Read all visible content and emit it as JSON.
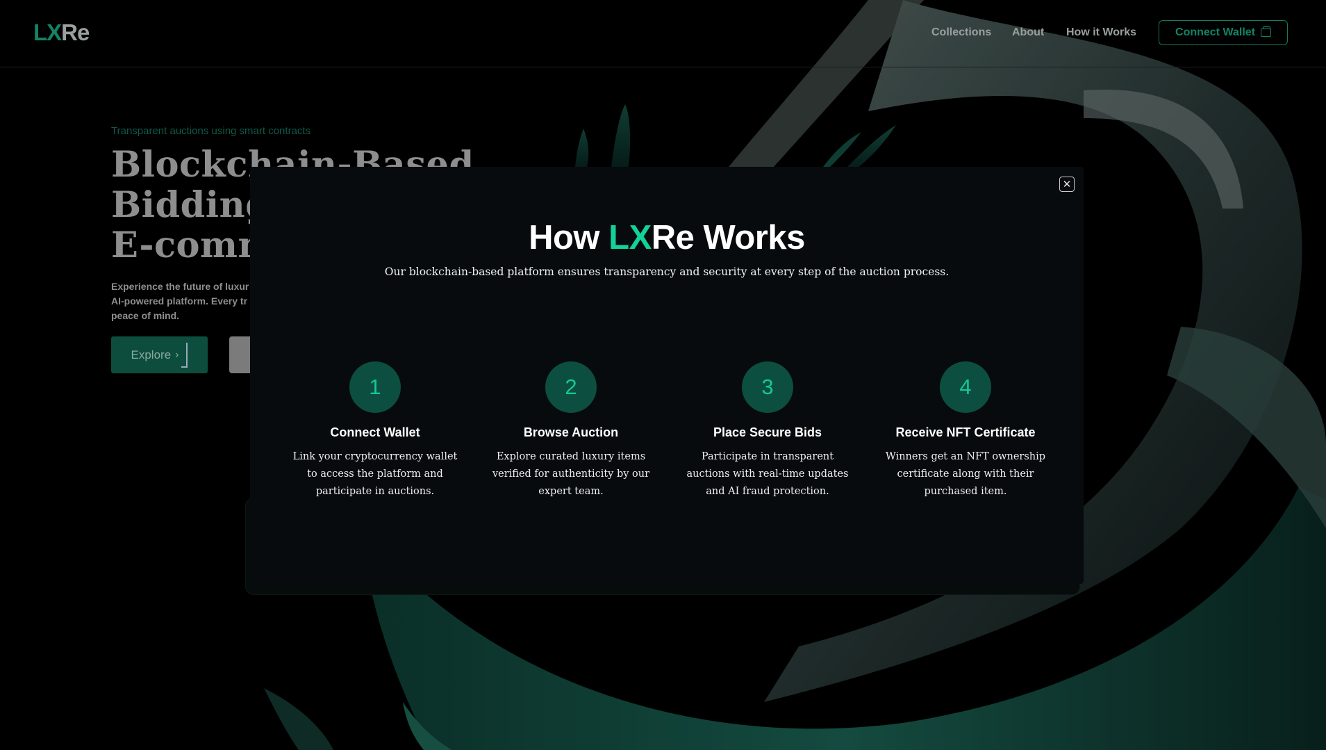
{
  "header": {
    "logo_lx": "LX",
    "logo_re": "Re",
    "nav": [
      {
        "label": "Collections"
      },
      {
        "label": "About"
      },
      {
        "label": "How it Works"
      }
    ],
    "connect_label": "Connect Wallet"
  },
  "hero": {
    "tagline": "Transparent auctions using smart contracts",
    "title_lines": [
      "Blockchain-Based",
      "Bidding S",
      "E-comm"
    ],
    "description_lines": [
      "Experience the future of luxur",
      "AI-powered platform. Every tr",
      "peace of mind."
    ],
    "explore_label": "Explore"
  },
  "modal": {
    "title_before": "How ",
    "title_accent": "LX",
    "title_after": "Re Works",
    "subtitle": "Our blockchain-based platform ensures transparency and security at every step of the auction process.",
    "close_symbol": "✕",
    "steps": [
      {
        "number": "1",
        "title": "Connect Wallet",
        "description": "Link your cryptocurrency wallet to access the platform and participate in auctions."
      },
      {
        "number": "2",
        "title": "Browse Auction",
        "description": "Explore curated luxury items verified for authenticity by our expert team."
      },
      {
        "number": "3",
        "title": "Place Secure Bids",
        "description": "Participate in transparent auctions with real-time updates and AI fraud protection."
      },
      {
        "number": "4",
        "title": "Receive NFT Certificate",
        "description": "Winners get an NFT ownership certificate along with their purchased item."
      }
    ]
  },
  "colors": {
    "accent": "#12d19a",
    "brand_dark": "#0c4f40",
    "background": "#000000",
    "modal_bg": "#070b0d"
  }
}
